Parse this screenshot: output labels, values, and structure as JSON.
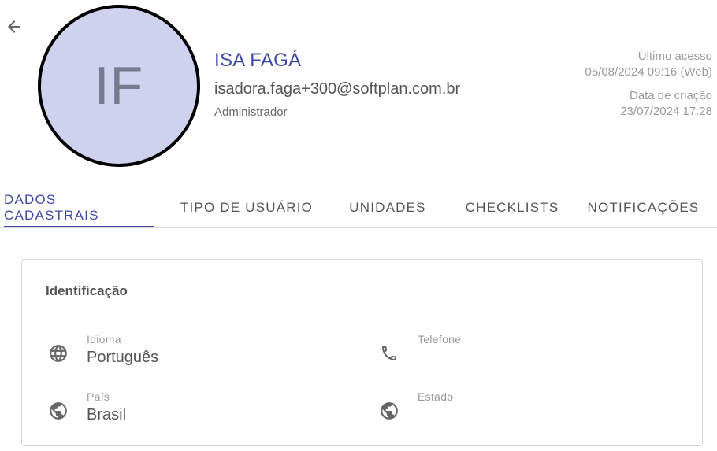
{
  "header": {
    "avatar_initials": "IF",
    "name": "ISA FAGÁ",
    "email": "isadora.faga+300@softplan.com.br",
    "role": "Administrador",
    "last_access_label": "Último acesso",
    "last_access_value": "05/08/2024 09:16 (Web)",
    "created_label": "Data de criação",
    "created_value": "23/07/2024 17:28"
  },
  "tabs": [
    {
      "label": "DADOS CADASTRAIS",
      "active": true
    },
    {
      "label": "TIPO DE USUÁRIO",
      "active": false
    },
    {
      "label": "UNIDADES",
      "active": false
    },
    {
      "label": "CHECKLISTS",
      "active": false
    },
    {
      "label": "NOTIFICAÇÕES",
      "active": false
    }
  ],
  "identification": {
    "title": "Identificação",
    "fields": [
      {
        "label": "Idioma",
        "value": "Português",
        "icon": "globe-icon"
      },
      {
        "label": "Telefone",
        "value": "",
        "icon": "phone-icon"
      },
      {
        "label": "País",
        "value": "Brasil",
        "icon": "earth-icon"
      },
      {
        "label": "Estado",
        "value": "",
        "icon": "earth-icon"
      }
    ]
  },
  "colors": {
    "accent": "#3d4aa3",
    "avatar_bg": "#cfd2ee",
    "muted_text": "#9a9a9a"
  }
}
